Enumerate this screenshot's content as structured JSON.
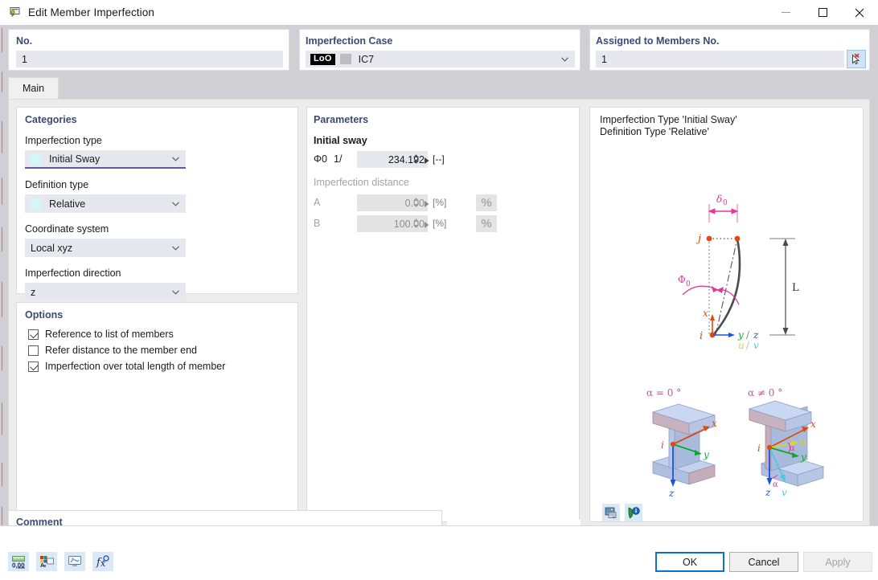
{
  "window": {
    "title": "Edit Member Imperfection",
    "icon": "member-imperfection-icon",
    "minimize_label": "—",
    "maximize_label": "□",
    "close_label": "✕"
  },
  "header": {
    "no": {
      "label": "No.",
      "value": "1"
    },
    "imperfection_case": {
      "label": "Imperfection Case",
      "tag": "LoO",
      "value": "IC7"
    },
    "assigned": {
      "label": "Assigned to Members No.",
      "value": "1",
      "pick_icon": "pick-member-cursor-icon"
    }
  },
  "tabs": [
    {
      "label": "Main",
      "selected": true
    }
  ],
  "categories": {
    "title": "Categories",
    "fields": [
      {
        "label": "Imperfection type",
        "value": "Initial Sway",
        "swatch": true,
        "focused": true
      },
      {
        "label": "Definition type",
        "value": "Relative",
        "swatch": true,
        "focused": false
      },
      {
        "label": "Coordinate system",
        "value": "Local xyz",
        "swatch": false,
        "focused": false
      },
      {
        "label": "Imperfection direction",
        "value": "z",
        "swatch": false,
        "focused": false
      }
    ]
  },
  "options": {
    "title": "Options",
    "items": [
      {
        "label": "Reference to list of members",
        "checked": true
      },
      {
        "label": "Refer distance to the member end",
        "checked": false
      },
      {
        "label": "Imperfection over total length of member",
        "checked": true
      }
    ]
  },
  "parameters": {
    "title": "Parameters",
    "initial_sway": {
      "section_label": "Initial sway",
      "symbol": "Φ0",
      "prefix": "1/",
      "value": "234.192",
      "unit": "[--]"
    },
    "imperfection_distance": {
      "section_label": "Imperfection distance",
      "rows": [
        {
          "label": "A",
          "value": "0.00",
          "unit": "[%]",
          "button": "%"
        },
        {
          "label": "B",
          "value": "100.00",
          "unit": "[%]",
          "button": "%"
        }
      ]
    }
  },
  "preview": {
    "line1": "Imperfection Type 'Initial Sway'",
    "line2": "Definition Type 'Relative'",
    "diagram_main": {
      "delta_label": "δ₀",
      "phi_label": "Φ₀",
      "length_label": "L",
      "node_start": "i",
      "node_end": "j",
      "axis_x": "x",
      "axis_y": "y",
      "axis_z": "z",
      "axis_u": "u",
      "axis_v": "v",
      "axis_sep": "/"
    },
    "sections": [
      {
        "caption": "α = 0 °",
        "axes": [
          "x",
          "y",
          "z"
        ]
      },
      {
        "caption": "α ≠ 0 °",
        "axes": [
          "x",
          "u",
          "y",
          "z",
          "v",
          "α"
        ]
      }
    ],
    "buttons": [
      {
        "icon": "image-export-icon"
      },
      {
        "icon": "info-help-icon"
      }
    ]
  },
  "comment": {
    "label": "Comment",
    "value": "",
    "placeholder": "",
    "copy_icon": "copy-windows-icon"
  },
  "statusbar_tools": [
    {
      "icon": "units-decimal-icon",
      "label": "0.00"
    },
    {
      "icon": "rendering-colors-icon",
      "label": ""
    },
    {
      "icon": "display-view-icon",
      "label": ""
    },
    {
      "icon": "formula-fx-icon",
      "label": ""
    }
  ],
  "footer_buttons": [
    {
      "label": "OK",
      "style": "primary"
    },
    {
      "label": "Cancel",
      "style": "normal"
    },
    {
      "label": "Apply",
      "style": "disabled"
    }
  ],
  "colors": {
    "accent_heading": "#3c4a74",
    "field_bg": "#e7e7f0",
    "dialog_bg": "#cfcfd4",
    "page_bg": "#ececec",
    "focus_underline": "#5b5ba0",
    "primary_border": "#0a72c8",
    "diagram_pink": "#e0399a",
    "diagram_orange": "#e04a12",
    "diagram_blue": "#1a53e0",
    "diagram_green": "#0fa82f",
    "beam_fill": "#a9bbdd"
  }
}
